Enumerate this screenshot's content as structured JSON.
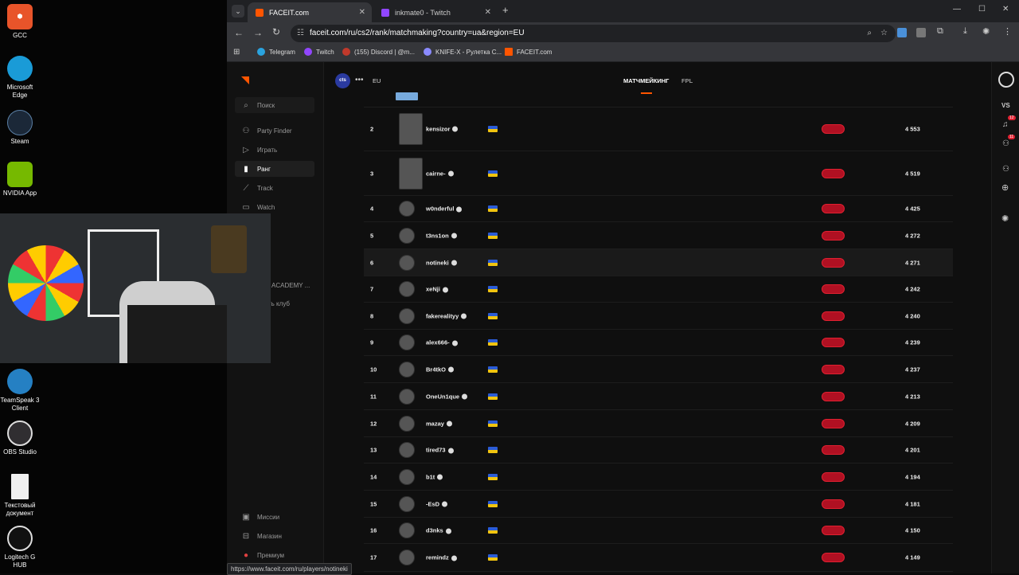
{
  "desktop": {
    "icons": [
      {
        "label": "GCC",
        "color": "#e8542a"
      },
      {
        "label": "Microsoft Edge",
        "color": "#1a9bd7"
      },
      {
        "label": "Steam",
        "color": "#1b2838"
      },
      {
        "label": "NVIDIA App",
        "color": "#76b900"
      },
      {
        "label": "TeamSpeak 3 Client",
        "color": "#2580c3"
      },
      {
        "label": "OBS Studio",
        "color": "#302e31"
      },
      {
        "label": "Текстовый документ",
        "color": "#f0f0f0"
      },
      {
        "label": "Logitech G HUB",
        "color": "#111111"
      }
    ]
  },
  "browser": {
    "tabs": [
      {
        "label": "FACEIT.com",
        "active": true
      },
      {
        "label": "inkmate0 - Twitch",
        "active": false
      }
    ],
    "url": "faceit.com/ru/cs2/rank/matchmaking?country=ua&region=EU",
    "bookmarks": [
      "Telegram",
      "Twitch",
      "(155) Discord | @m...",
      "KNIFE-X - Рулетка С...",
      "FACEIT.com"
    ]
  },
  "nav": {
    "search": "Поиск",
    "items": [
      "Party Finder",
      "Играть",
      "Ранг",
      "Track",
      "Watch"
    ],
    "partial": [
      "ACADEMY ...",
      "ть клуб"
    ],
    "bottom": [
      "Миссии",
      "Магазин",
      "Премиум"
    ]
  },
  "topbar": {
    "team": "cts",
    "region": "EU",
    "tabs": [
      "МАТЧМЕЙКИНГ",
      "FPL"
    ]
  },
  "rail": {
    "vs": "VS",
    "badge1": "12",
    "badge2": "11"
  },
  "ranking": [
    {
      "rank": "2",
      "name": "kensizor",
      "elo": "4 553"
    },
    {
      "rank": "3",
      "name": "cairne-",
      "elo": "4 519"
    },
    {
      "rank": "4",
      "name": "w0nderful",
      "elo": "4 425"
    },
    {
      "rank": "5",
      "name": "t3ns1on",
      "elo": "4 272"
    },
    {
      "rank": "6",
      "name": "notineki",
      "elo": "4 271"
    },
    {
      "rank": "7",
      "name": "xeNji",
      "elo": "4 242"
    },
    {
      "rank": "8",
      "name": "fakerealityy",
      "elo": "4 240"
    },
    {
      "rank": "9",
      "name": "alex666-",
      "elo": "4 239"
    },
    {
      "rank": "10",
      "name": "Br4tkO",
      "elo": "4 237"
    },
    {
      "rank": "11",
      "name": "OneUn1que",
      "elo": "4 213"
    },
    {
      "rank": "12",
      "name": "mazay",
      "elo": "4 209"
    },
    {
      "rank": "13",
      "name": "tired73",
      "elo": "4 201"
    },
    {
      "rank": "14",
      "name": "b1t",
      "elo": "4 194"
    },
    {
      "rank": "15",
      "name": "-EsD",
      "elo": "4 181"
    },
    {
      "rank": "16",
      "name": "d3nks",
      "elo": "4 150"
    },
    {
      "rank": "17",
      "name": "remindz",
      "elo": "4 149"
    }
  ],
  "status": "https://www.faceit.com/ru/players/notineki"
}
